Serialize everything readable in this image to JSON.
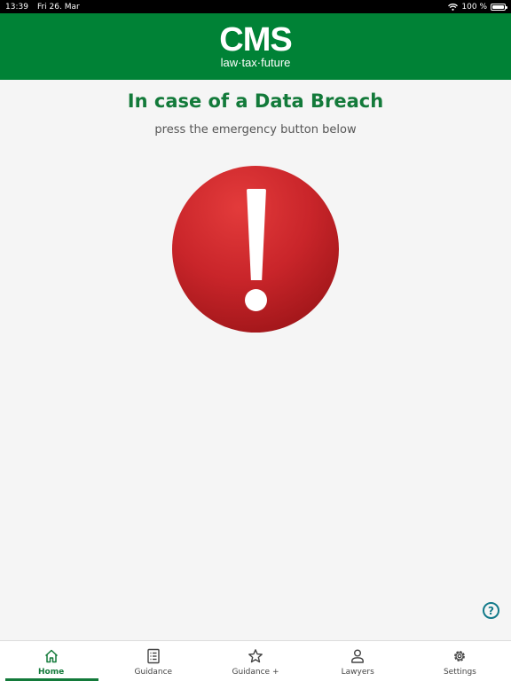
{
  "status_bar": {
    "time": "13:39",
    "date": "Fri 26. Mar",
    "battery": "100 %",
    "battery_level": 1.0
  },
  "header": {
    "logo_text": "CMS",
    "tagline": "law·tax·future"
  },
  "main": {
    "title": "In case of a Data Breach",
    "subtitle": "press the emergency button below",
    "emergency_icon": "exclamation-icon",
    "help_label": "?"
  },
  "tabs": [
    {
      "label": "Home",
      "icon": "home-icon",
      "active": true
    },
    {
      "label": "Guidance",
      "icon": "document-list-icon",
      "active": false
    },
    {
      "label": "Guidance +",
      "icon": "star-icon",
      "active": false
    },
    {
      "label": "Lawyers",
      "icon": "person-icon",
      "active": false
    },
    {
      "label": "Settings",
      "icon": "gear-icon",
      "active": false
    }
  ],
  "colors": {
    "brand_green": "#008236",
    "title_green": "#137a3a",
    "emergency_red": "#c9252a",
    "help_teal": "#137a8a"
  }
}
